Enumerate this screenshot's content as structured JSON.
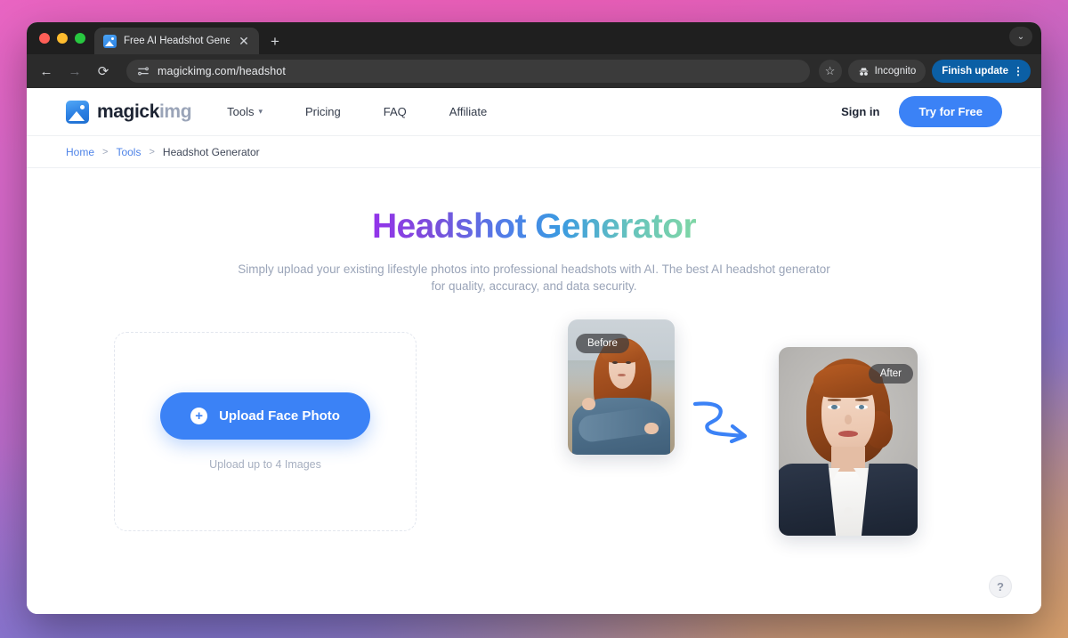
{
  "browser": {
    "tab": {
      "title": "Free AI Headshot Generator |",
      "favicon_name": "magickimg-favicon",
      "close_label": "✕"
    },
    "new_tab_label": "+",
    "tab_list_label": "⌄",
    "toolbar": {
      "back_label": "←",
      "forward_label": "→",
      "reload_label": "⟳",
      "url": "magickimg.com/headshot",
      "site_settings_icon": "tune-icon",
      "star_label": "☆",
      "incognito_label": "Incognito",
      "update_label": "Finish update",
      "menu_label": "⋮"
    }
  },
  "site": {
    "logo": {
      "primary": "magick",
      "secondary": "img"
    },
    "nav": [
      {
        "label": "Tools",
        "has_dropdown": true,
        "chevron": "▾"
      },
      {
        "label": "Pricing",
        "has_dropdown": false
      },
      {
        "label": "FAQ",
        "has_dropdown": false
      },
      {
        "label": "Affiliate",
        "has_dropdown": false
      }
    ],
    "sign_in_label": "Sign in",
    "cta_label": "Try for Free"
  },
  "breadcrumb": {
    "home": "Home",
    "sep1": ">",
    "tools": "Tools",
    "sep2": ">",
    "current": "Headshot Generator"
  },
  "hero": {
    "title": "Headshot Generator",
    "subtitle": "Simply upload your existing lifestyle photos into professional headshots with AI. The best AI headshot generator for quality, accuracy, and data security."
  },
  "upload": {
    "button_label": "Upload Face Photo",
    "plus_icon": "+",
    "hint": "Upload up to 4 Images"
  },
  "comparison": {
    "before_badge": "Before",
    "after_badge": "After",
    "arrow_icon": "squiggly-arrow-icon",
    "before_alt": "Woman with red hair in blue sweater outdoors",
    "after_alt": "Professional headshot of woman in navy blazer"
  },
  "help": {
    "label": "?"
  },
  "colors": {
    "accent_blue": "#3b82f6",
    "update_blue": "#0b5fa5",
    "link_blue": "#4f84e8",
    "title_gradient_start": "#9333ea",
    "title_gradient_mid": "#3b9ae1",
    "title_gradient_end": "#7fd6a5",
    "muted_text": "#9aa4b8"
  }
}
